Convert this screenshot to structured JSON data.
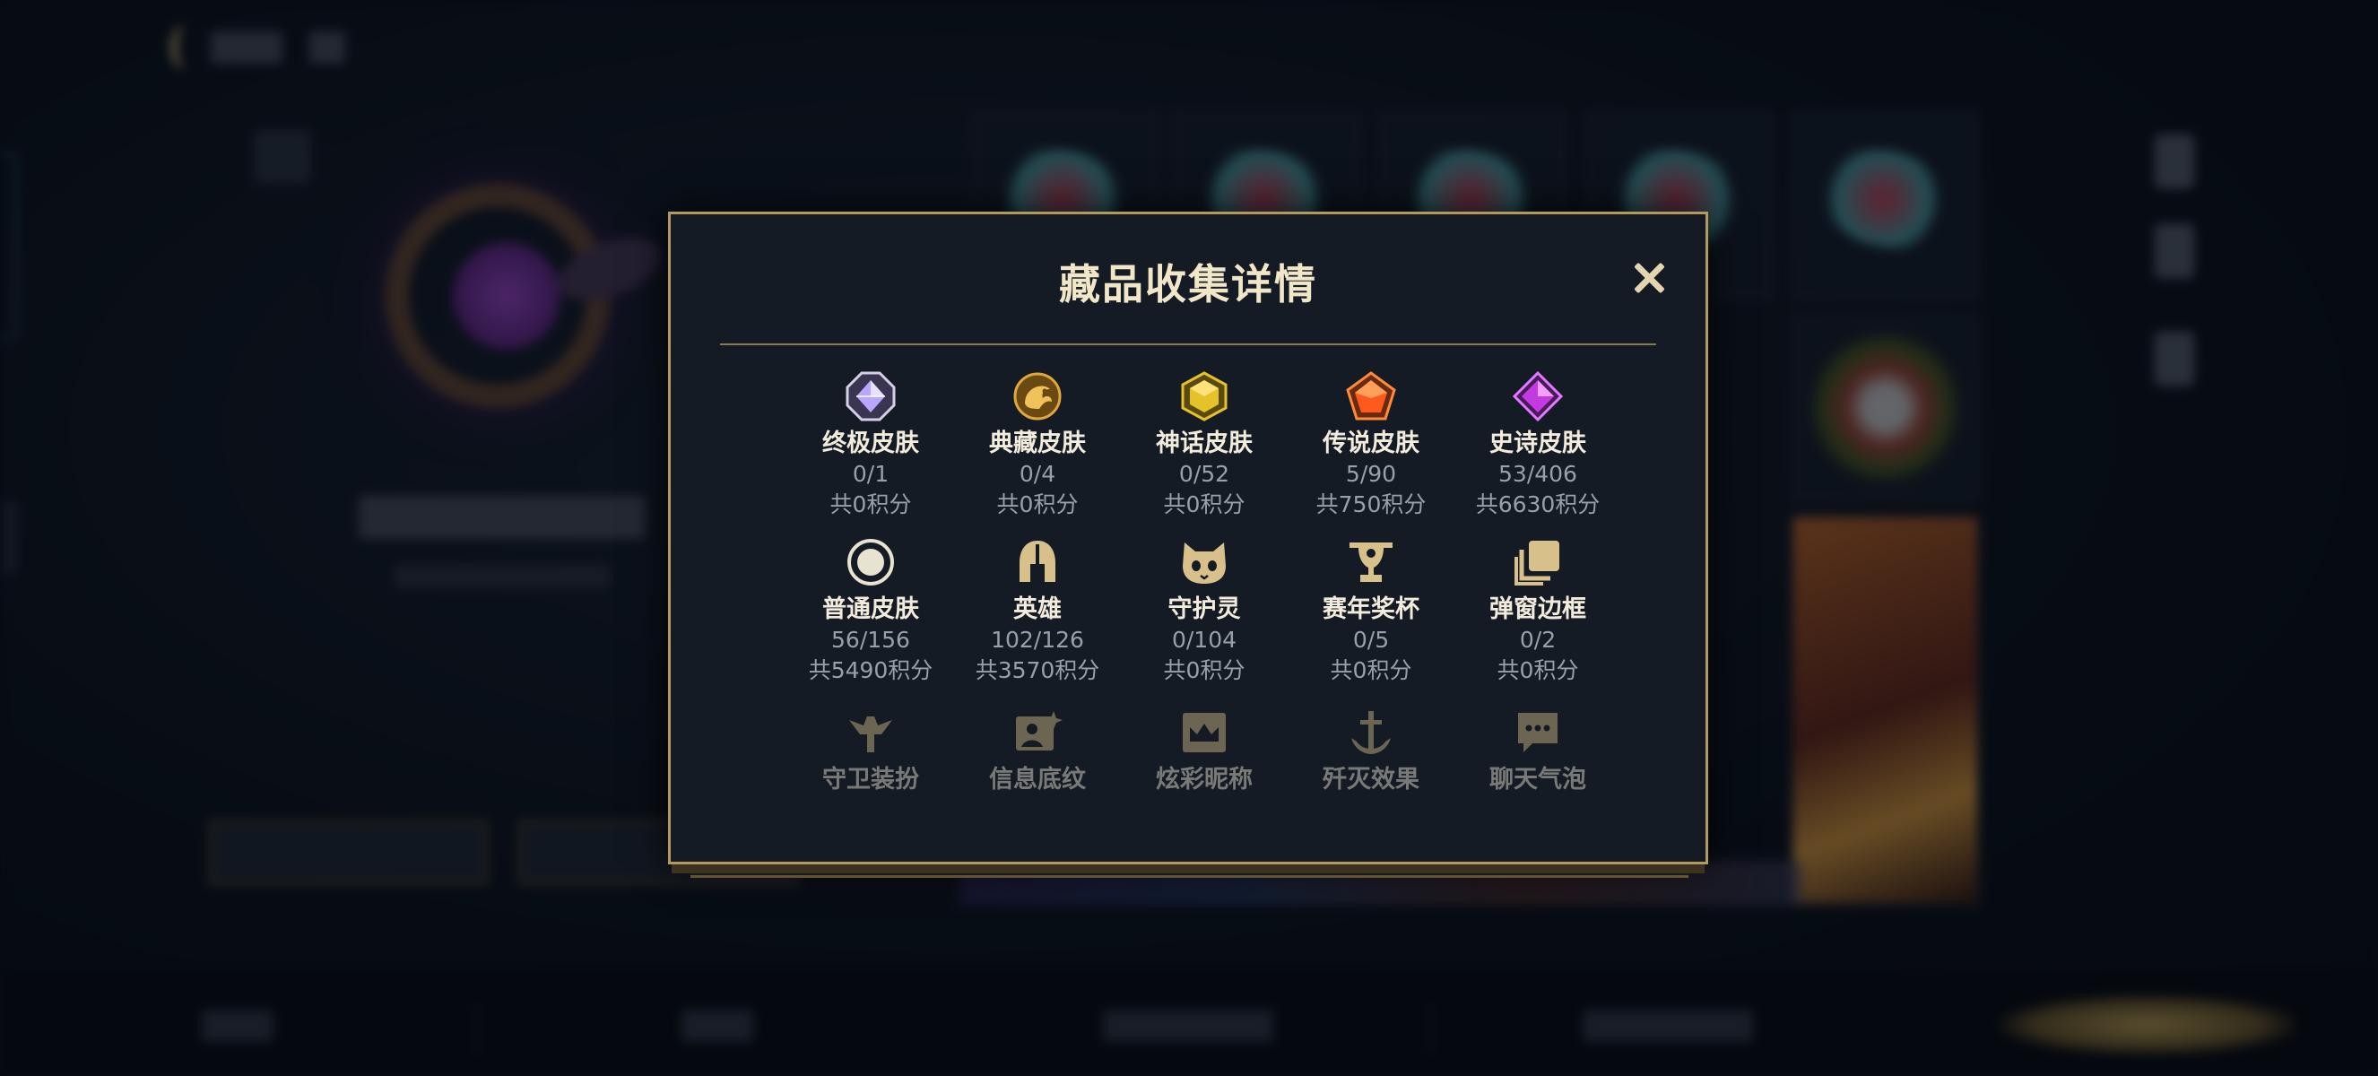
{
  "modal": {
    "title": "藏品收集详情",
    "close_icon": "close-icon"
  },
  "collection": [
    {
      "id": "ultimate-skin",
      "label": "终极皮肤",
      "count": "0/1",
      "points": "共0积分",
      "icon": "octagon-gem-icon",
      "color": "#b9a6ff"
    },
    {
      "id": "prestige-skin",
      "label": "典藏皮肤",
      "count": "0/4",
      "points": "共0积分",
      "icon": "dragon-emblem-icon",
      "color": "#e0a83a"
    },
    {
      "id": "mythic-skin",
      "label": "神话皮肤",
      "count": "0/52",
      "points": "共0积分",
      "icon": "hexagon-gem-icon",
      "color": "#e6c22a"
    },
    {
      "id": "legendary-skin",
      "label": "传说皮肤",
      "count": "5/90",
      "points": "共750积分",
      "icon": "pentagon-gem-icon",
      "color": "#ff6a1e"
    },
    {
      "id": "epic-skin",
      "label": "史诗皮肤",
      "count": "53/406",
      "points": "共6630积分",
      "icon": "diamond-gem-icon",
      "color": "#c33be0"
    },
    {
      "id": "normal-skin",
      "label": "普通皮肤",
      "count": "56/156",
      "points": "共5490积分",
      "icon": "circle-gem-icon",
      "color": "#e8e2d0"
    },
    {
      "id": "champion",
      "label": "英雄",
      "count": "102/126",
      "points": "共3570积分",
      "icon": "helmet-icon",
      "color": "#d8c08a"
    },
    {
      "id": "guardian-spirit",
      "label": "守护灵",
      "count": "0/104",
      "points": "共0积分",
      "icon": "cat-face-icon",
      "color": "#d8c08a"
    },
    {
      "id": "season-trophy",
      "label": "赛年奖杯",
      "count": "0/5",
      "points": "共0积分",
      "icon": "trophy-icon",
      "color": "#d8c08a"
    },
    {
      "id": "popup-frame",
      "label": "弹窗边框",
      "count": "0/2",
      "points": "共0积分",
      "icon": "stacked-frames-icon",
      "color": "#d8c08a"
    },
    {
      "id": "guardian-outfit",
      "label": "守卫装扮",
      "count": "",
      "points": "",
      "icon": "ward-icon",
      "color": "#d8c08a"
    },
    {
      "id": "info-background",
      "label": "信息底纹",
      "count": "",
      "points": "",
      "icon": "image-sparkle-icon",
      "color": "#d8c08a"
    },
    {
      "id": "fancy-nickname",
      "label": "炫彩昵称",
      "count": "",
      "points": "",
      "icon": "crown-card-icon",
      "color": "#d8c08a"
    },
    {
      "id": "kill-effect",
      "label": "歼灭效果",
      "count": "",
      "points": "",
      "icon": "anchor-sword-icon",
      "color": "#d8c08a"
    },
    {
      "id": "chat-bubble",
      "label": "聊天气泡",
      "count": "",
      "points": "",
      "icon": "chat-bubble-icon",
      "color": "#d8c08a"
    }
  ]
}
